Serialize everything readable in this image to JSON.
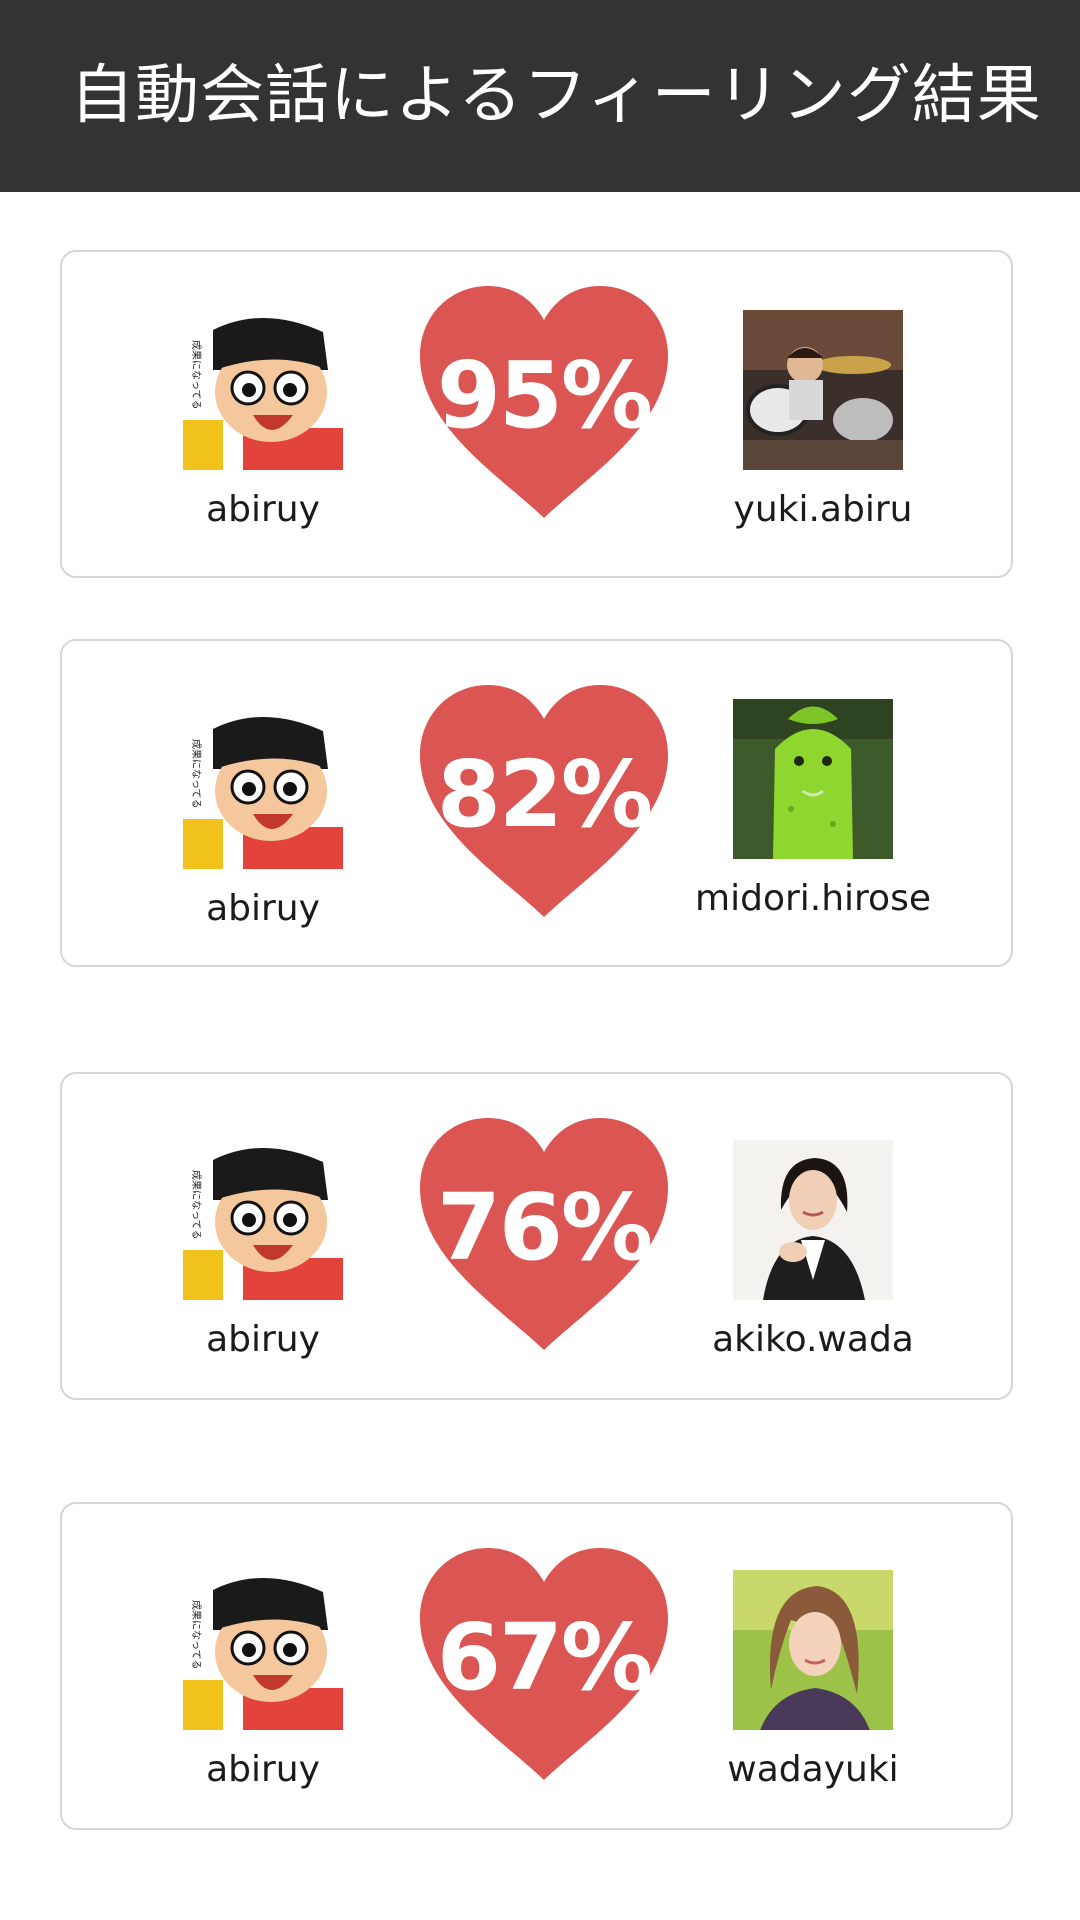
{
  "header": {
    "title": "自動会話によるフィーリング結果"
  },
  "colors": {
    "heart": "#DB5552",
    "header_bg": "#333333",
    "card_border": "#D6D6D6"
  },
  "results": [
    {
      "left_user": "abiruy",
      "right_user": "yuki.abiru",
      "score": "95%"
    },
    {
      "left_user": "abiruy",
      "right_user": "midori.hirose",
      "score": "82%"
    },
    {
      "left_user": "abiruy",
      "right_user": "akiko.wada",
      "score": "76%"
    },
    {
      "left_user": "abiruy",
      "right_user": "wadayuki",
      "score": "67%"
    }
  ],
  "avatars": {
    "left": "manga-character-avatar",
    "right": [
      "drummer-photo-avatar",
      "green-plush-avatar",
      "woman-portrait-avatar",
      "woman-outdoor-avatar"
    ]
  }
}
